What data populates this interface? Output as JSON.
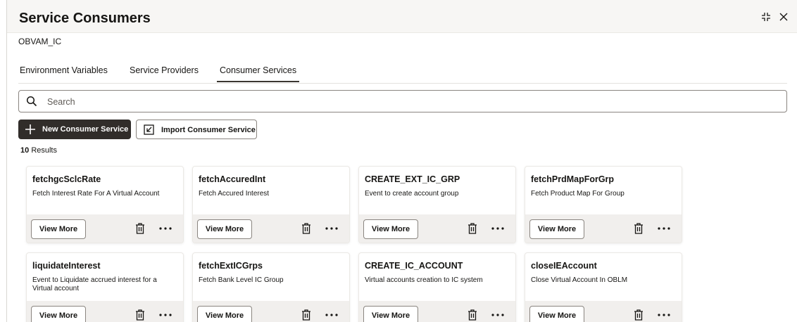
{
  "header": {
    "title": "Service Consumers"
  },
  "subtitle": "OBVAM_IC",
  "tabs": [
    {
      "label": "Environment Variables"
    },
    {
      "label": "Service Providers"
    },
    {
      "label": "Consumer Services"
    }
  ],
  "active_tab": "Consumer Services",
  "search": {
    "placeholder": "Search",
    "value": ""
  },
  "toolbar": {
    "new_label": "New Consumer Service",
    "import_label": "Import Consumer Service"
  },
  "results": {
    "count": "10",
    "label": "Results"
  },
  "cards": [
    {
      "title": "fetchgcSclcRate",
      "description": "Fetch Interest Rate For A Virtual Account",
      "button": "View More"
    },
    {
      "title": "fetchAccuredInt",
      "description": "Fetch Accured Interest",
      "button": "View More"
    },
    {
      "title": "CREATE_EXT_IC_GRP",
      "description": "Event to create account group",
      "button": "View More"
    },
    {
      "title": "fetchPrdMapForGrp",
      "description": "Fetch Product Map For Group",
      "button": "View More"
    },
    {
      "title": "liquidateInterest",
      "description": "Event to Liquidate accrued interest for a Virtual account",
      "button": "View More"
    },
    {
      "title": "fetchExtICGrps",
      "description": "Fetch Bank Level IC Group",
      "button": "View More"
    },
    {
      "title": "CREATE_IC_ACCOUNT",
      "description": "Virtual accounts creation to IC system",
      "button": "View More"
    },
    {
      "title": "closeIEAccount",
      "description": "Close Virtual Account In OBLM",
      "button": "View More"
    }
  ],
  "colors": {
    "primary": "#312d2a",
    "border": "#8a8580",
    "footer": "#f1efed",
    "header": "#f7f6f4"
  },
  "icons": [
    "maximize-icon",
    "close-icon",
    "search-icon",
    "plus-icon",
    "import-icon",
    "trash-icon",
    "more-icon"
  ]
}
